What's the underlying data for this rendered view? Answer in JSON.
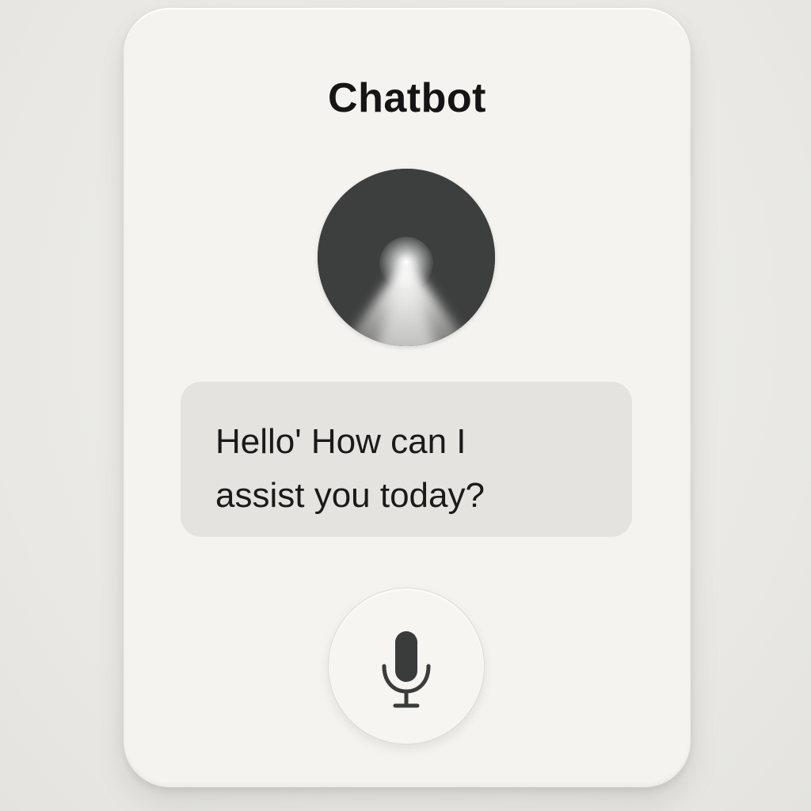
{
  "app": {
    "title": "Chatbot"
  },
  "avatar": {
    "icon": "assistant-orb-icon",
    "color": "#3d3e3e"
  },
  "message": {
    "text": "Hello' How can I\nassist you today?"
  },
  "mic_button": {
    "icon": "microphone-icon",
    "color": "#3a3b3b"
  },
  "colors": {
    "background": "#ecebe7",
    "card": "#f4f3ef",
    "bubble": "#e4e3df",
    "text": "#151515"
  }
}
